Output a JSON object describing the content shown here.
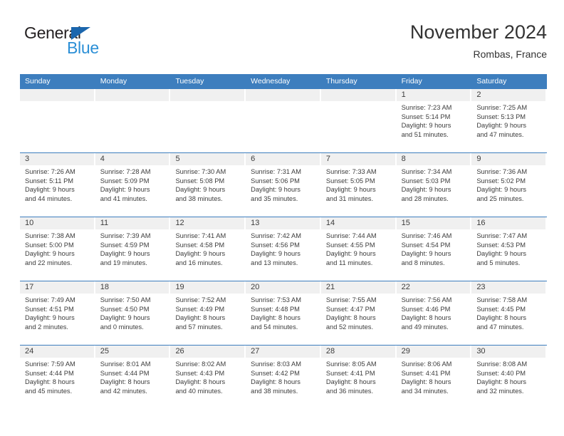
{
  "logo": {
    "word1": "General",
    "word2": "Blue",
    "triangle_color": "#1b66ad",
    "word1_color": "#231f20",
    "word2_color": "#2b8fd6"
  },
  "header": {
    "month_title": "November 2024",
    "location": "Rombas, France"
  },
  "theme": {
    "header_blue": "#3d7ebe",
    "day_head_gray": "#f0f0f0",
    "text_color": "#3c3c3c"
  },
  "weekdays": [
    "Sunday",
    "Monday",
    "Tuesday",
    "Wednesday",
    "Thursday",
    "Friday",
    "Saturday"
  ],
  "weeks": [
    [
      {
        "day": "",
        "lines": []
      },
      {
        "day": "",
        "lines": []
      },
      {
        "day": "",
        "lines": []
      },
      {
        "day": "",
        "lines": []
      },
      {
        "day": "",
        "lines": []
      },
      {
        "day": "1",
        "lines": [
          "Sunrise: 7:23 AM",
          "Sunset: 5:14 PM",
          "Daylight: 9 hours",
          "and 51 minutes."
        ]
      },
      {
        "day": "2",
        "lines": [
          "Sunrise: 7:25 AM",
          "Sunset: 5:13 PM",
          "Daylight: 9 hours",
          "and 47 minutes."
        ]
      }
    ],
    [
      {
        "day": "3",
        "lines": [
          "Sunrise: 7:26 AM",
          "Sunset: 5:11 PM",
          "Daylight: 9 hours",
          "and 44 minutes."
        ]
      },
      {
        "day": "4",
        "lines": [
          "Sunrise: 7:28 AM",
          "Sunset: 5:09 PM",
          "Daylight: 9 hours",
          "and 41 minutes."
        ]
      },
      {
        "day": "5",
        "lines": [
          "Sunrise: 7:30 AM",
          "Sunset: 5:08 PM",
          "Daylight: 9 hours",
          "and 38 minutes."
        ]
      },
      {
        "day": "6",
        "lines": [
          "Sunrise: 7:31 AM",
          "Sunset: 5:06 PM",
          "Daylight: 9 hours",
          "and 35 minutes."
        ]
      },
      {
        "day": "7",
        "lines": [
          "Sunrise: 7:33 AM",
          "Sunset: 5:05 PM",
          "Daylight: 9 hours",
          "and 31 minutes."
        ]
      },
      {
        "day": "8",
        "lines": [
          "Sunrise: 7:34 AM",
          "Sunset: 5:03 PM",
          "Daylight: 9 hours",
          "and 28 minutes."
        ]
      },
      {
        "day": "9",
        "lines": [
          "Sunrise: 7:36 AM",
          "Sunset: 5:02 PM",
          "Daylight: 9 hours",
          "and 25 minutes."
        ]
      }
    ],
    [
      {
        "day": "10",
        "lines": [
          "Sunrise: 7:38 AM",
          "Sunset: 5:00 PM",
          "Daylight: 9 hours",
          "and 22 minutes."
        ]
      },
      {
        "day": "11",
        "lines": [
          "Sunrise: 7:39 AM",
          "Sunset: 4:59 PM",
          "Daylight: 9 hours",
          "and 19 minutes."
        ]
      },
      {
        "day": "12",
        "lines": [
          "Sunrise: 7:41 AM",
          "Sunset: 4:58 PM",
          "Daylight: 9 hours",
          "and 16 minutes."
        ]
      },
      {
        "day": "13",
        "lines": [
          "Sunrise: 7:42 AM",
          "Sunset: 4:56 PM",
          "Daylight: 9 hours",
          "and 13 minutes."
        ]
      },
      {
        "day": "14",
        "lines": [
          "Sunrise: 7:44 AM",
          "Sunset: 4:55 PM",
          "Daylight: 9 hours",
          "and 11 minutes."
        ]
      },
      {
        "day": "15",
        "lines": [
          "Sunrise: 7:46 AM",
          "Sunset: 4:54 PM",
          "Daylight: 9 hours",
          "and 8 minutes."
        ]
      },
      {
        "day": "16",
        "lines": [
          "Sunrise: 7:47 AM",
          "Sunset: 4:53 PM",
          "Daylight: 9 hours",
          "and 5 minutes."
        ]
      }
    ],
    [
      {
        "day": "17",
        "lines": [
          "Sunrise: 7:49 AM",
          "Sunset: 4:51 PM",
          "Daylight: 9 hours",
          "and 2 minutes."
        ]
      },
      {
        "day": "18",
        "lines": [
          "Sunrise: 7:50 AM",
          "Sunset: 4:50 PM",
          "Daylight: 9 hours",
          "and 0 minutes."
        ]
      },
      {
        "day": "19",
        "lines": [
          "Sunrise: 7:52 AM",
          "Sunset: 4:49 PM",
          "Daylight: 8 hours",
          "and 57 minutes."
        ]
      },
      {
        "day": "20",
        "lines": [
          "Sunrise: 7:53 AM",
          "Sunset: 4:48 PM",
          "Daylight: 8 hours",
          "and 54 minutes."
        ]
      },
      {
        "day": "21",
        "lines": [
          "Sunrise: 7:55 AM",
          "Sunset: 4:47 PM",
          "Daylight: 8 hours",
          "and 52 minutes."
        ]
      },
      {
        "day": "22",
        "lines": [
          "Sunrise: 7:56 AM",
          "Sunset: 4:46 PM",
          "Daylight: 8 hours",
          "and 49 minutes."
        ]
      },
      {
        "day": "23",
        "lines": [
          "Sunrise: 7:58 AM",
          "Sunset: 4:45 PM",
          "Daylight: 8 hours",
          "and 47 minutes."
        ]
      }
    ],
    [
      {
        "day": "24",
        "lines": [
          "Sunrise: 7:59 AM",
          "Sunset: 4:44 PM",
          "Daylight: 8 hours",
          "and 45 minutes."
        ]
      },
      {
        "day": "25",
        "lines": [
          "Sunrise: 8:01 AM",
          "Sunset: 4:44 PM",
          "Daylight: 8 hours",
          "and 42 minutes."
        ]
      },
      {
        "day": "26",
        "lines": [
          "Sunrise: 8:02 AM",
          "Sunset: 4:43 PM",
          "Daylight: 8 hours",
          "and 40 minutes."
        ]
      },
      {
        "day": "27",
        "lines": [
          "Sunrise: 8:03 AM",
          "Sunset: 4:42 PM",
          "Daylight: 8 hours",
          "and 38 minutes."
        ]
      },
      {
        "day": "28",
        "lines": [
          "Sunrise: 8:05 AM",
          "Sunset: 4:41 PM",
          "Daylight: 8 hours",
          "and 36 minutes."
        ]
      },
      {
        "day": "29",
        "lines": [
          "Sunrise: 8:06 AM",
          "Sunset: 4:41 PM",
          "Daylight: 8 hours",
          "and 34 minutes."
        ]
      },
      {
        "day": "30",
        "lines": [
          "Sunrise: 8:08 AM",
          "Sunset: 4:40 PM",
          "Daylight: 8 hours",
          "and 32 minutes."
        ]
      }
    ]
  ]
}
